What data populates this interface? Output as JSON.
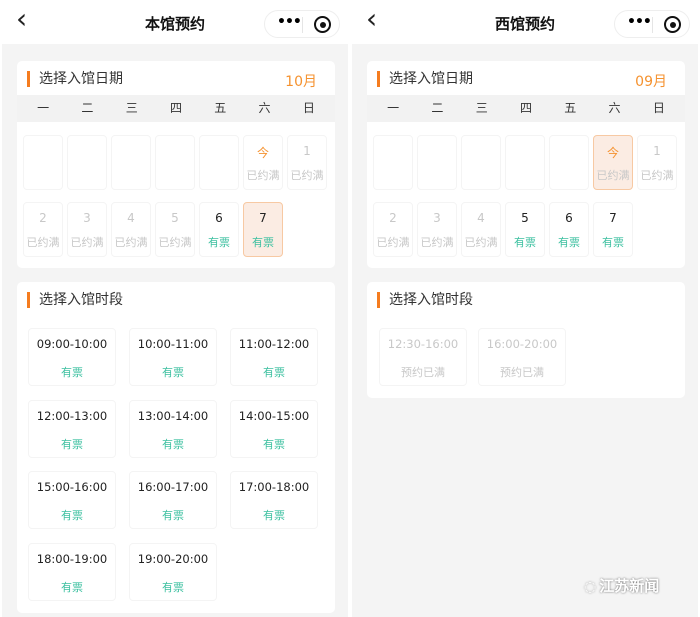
{
  "colors": {
    "accent": "#f57c1f",
    "available": "#3cc0a0",
    "full": "#c8c8c8",
    "today": "#f5922f"
  },
  "weekdays": [
    "一",
    "二",
    "三",
    "四",
    "五",
    "六",
    "日"
  ],
  "pages": [
    {
      "title": "本馆预约",
      "date_section_title": "选择入馆日期",
      "month": "10月",
      "time_section_title": "选择入馆时段",
      "days": [
        {
          "col": 5,
          "row": 0,
          "num": "今",
          "status": "已约满",
          "state": "full",
          "today": true
        },
        {
          "col": 6,
          "row": 0,
          "num": "1",
          "status": "已约满",
          "state": "full"
        },
        {
          "col": 0,
          "row": 1,
          "num": "2",
          "status": "已约满",
          "state": "full"
        },
        {
          "col": 1,
          "row": 1,
          "num": "3",
          "status": "已约满",
          "state": "full"
        },
        {
          "col": 2,
          "row": 1,
          "num": "4",
          "status": "已约满",
          "state": "full"
        },
        {
          "col": 3,
          "row": 1,
          "num": "5",
          "status": "已约满",
          "state": "full"
        },
        {
          "col": 4,
          "row": 1,
          "num": "6",
          "status": "有票",
          "state": "open"
        },
        {
          "col": 5,
          "row": 1,
          "num": "7",
          "status": "有票",
          "state": "open",
          "selected": true
        }
      ],
      "slots": [
        {
          "time": "09:00-10:00",
          "status": "有票",
          "state": "open"
        },
        {
          "time": "10:00-11:00",
          "status": "有票",
          "state": "open"
        },
        {
          "time": "11:00-12:00",
          "status": "有票",
          "state": "open"
        },
        {
          "time": "12:00-13:00",
          "status": "有票",
          "state": "open"
        },
        {
          "time": "13:00-14:00",
          "status": "有票",
          "state": "open"
        },
        {
          "time": "14:00-15:00",
          "status": "有票",
          "state": "open"
        },
        {
          "time": "15:00-16:00",
          "status": "有票",
          "state": "open"
        },
        {
          "time": "16:00-17:00",
          "status": "有票",
          "state": "open"
        },
        {
          "time": "17:00-18:00",
          "status": "有票",
          "state": "open"
        },
        {
          "time": "18:00-19:00",
          "status": "有票",
          "state": "open"
        },
        {
          "time": "19:00-20:00",
          "status": "有票",
          "state": "open"
        }
      ]
    },
    {
      "title": "西馆预约",
      "date_section_title": "选择入馆日期",
      "month": "09月",
      "time_section_title": "选择入馆时段",
      "days": [
        {
          "col": 5,
          "row": 0,
          "num": "今",
          "status": "已约满",
          "state": "full",
          "today": true,
          "selected": true
        },
        {
          "col": 6,
          "row": 0,
          "num": "1",
          "status": "已约满",
          "state": "full"
        },
        {
          "col": 0,
          "row": 1,
          "num": "2",
          "status": "已约满",
          "state": "full"
        },
        {
          "col": 1,
          "row": 1,
          "num": "3",
          "status": "已约满",
          "state": "full"
        },
        {
          "col": 2,
          "row": 1,
          "num": "4",
          "status": "已约满",
          "state": "full"
        },
        {
          "col": 3,
          "row": 1,
          "num": "5",
          "status": "有票",
          "state": "open"
        },
        {
          "col": 4,
          "row": 1,
          "num": "6",
          "status": "有票",
          "state": "open"
        },
        {
          "col": 5,
          "row": 1,
          "num": "7",
          "status": "有票",
          "state": "open"
        }
      ],
      "slots": [
        {
          "time": "12:30-16:00",
          "status": "预约已满",
          "state": "full"
        },
        {
          "time": "16:00-20:00",
          "status": "预约已满",
          "state": "full"
        }
      ]
    }
  ],
  "watermark": "江苏新闻"
}
